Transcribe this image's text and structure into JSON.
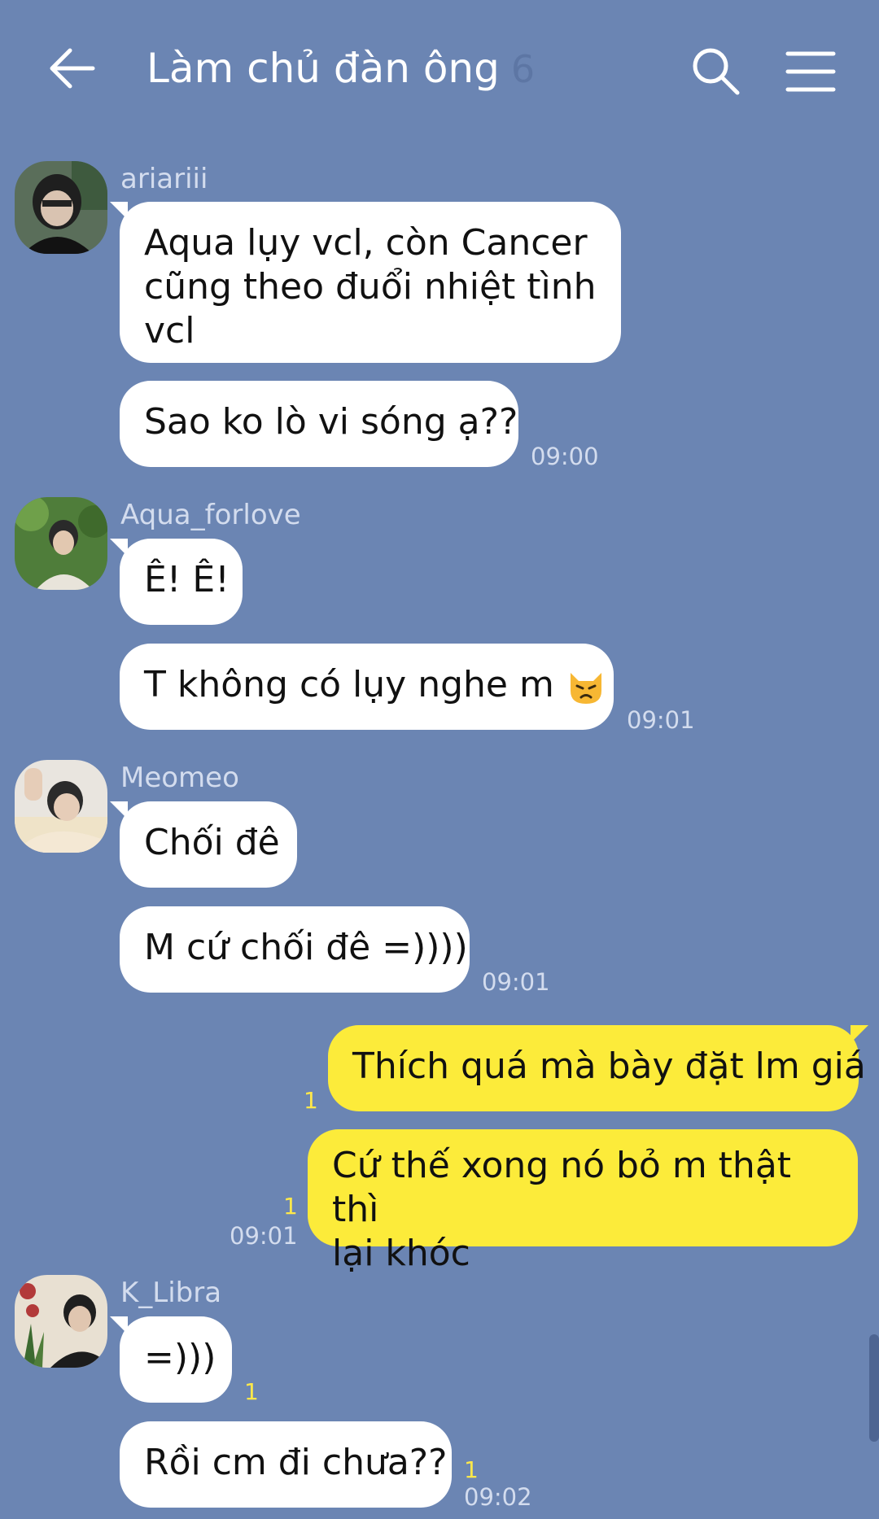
{
  "header": {
    "title": "Làm chủ đàn ông",
    "member_count": "6"
  },
  "colors": {
    "background": "#6b85b3",
    "incoming_bubble": "#ffffff",
    "outgoing_bubble": "#fceb3a",
    "unread_count": "#ffe84a"
  },
  "messages": [
    {
      "sender": "ariariii",
      "lines": [
        "Aqua lụy vcl, còn Cancer",
        "cũng theo đuổi nhiệt tình",
        "vcl"
      ]
    },
    {
      "sender": "ariariii",
      "text": "Sao ko lò vi sóng ạ??",
      "time": "09:00"
    },
    {
      "sender": "Aqua_forlove",
      "text": "Ê! Ê!"
    },
    {
      "sender": "Aqua_forlove",
      "text": "T không có lụy nghe m",
      "emoji": "pouting-cat-emoji",
      "time": "09:01"
    },
    {
      "sender": "Meomeo",
      "text": "Chối đê"
    },
    {
      "sender": "Meomeo",
      "text": "M cứ chối đê =))))",
      "time": "09:01"
    },
    {
      "sender": "me",
      "text": "Thích quá mà bày đặt lm giá",
      "unread": "1"
    },
    {
      "sender": "me",
      "lines": [
        "Cứ thế xong nó bỏ m thật thì",
        "lại khóc"
      ],
      "unread": "1",
      "time": "09:01"
    },
    {
      "sender": "K_Libra",
      "text": "=)))",
      "unread": "1"
    },
    {
      "sender": "K_Libra",
      "text": "Rồi cm đi chưa??",
      "unread": "1",
      "time": "09:02"
    }
  ]
}
